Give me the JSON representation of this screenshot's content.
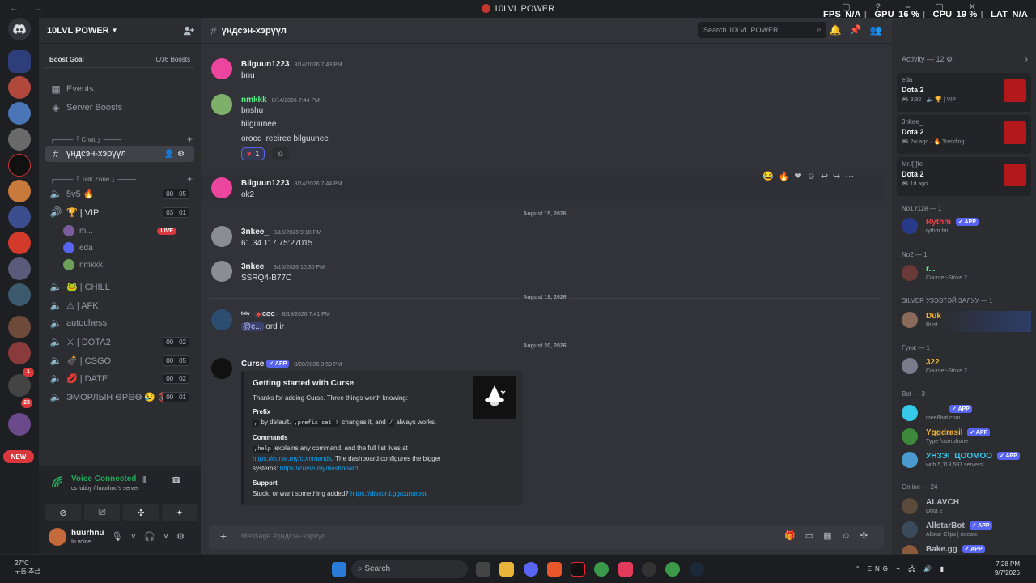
{
  "window": {
    "title": "10LVL POWER",
    "nav": "← →"
  },
  "overlay": {
    "fps_label": "FPS",
    "fps": "N/A",
    "gpu_label": "GPU",
    "gpu": "16 %",
    "cpu_label": "CPU",
    "cpu": "19 %",
    "lat_label": "LAT",
    "lat": "N/A"
  },
  "guild_rail": {
    "new_label": "NEW",
    "badge_1": "1",
    "badge_23": "23"
  },
  "server": {
    "name": "10LVL POWER",
    "boost_goal": "Boost Goal",
    "boost_count": "0/36 Boosts",
    "events": "Events",
    "server_boosts": "Server Boosts",
    "cat_chat": "┌────「 Chat 」────",
    "cat_talk": "┌────「 Talk Zone 」────",
    "active_channel": "үндсэн-хэрүүл",
    "voice_channels": [
      {
        "name": "5v5 🔥",
        "a": "00",
        "b": "05"
      },
      {
        "name": "🏆 | VIP",
        "a": "03",
        "b": "01"
      },
      {
        "name": "🐸 | CHILL"
      },
      {
        "name": "⚠ | AFK"
      },
      {
        "name": "autochess"
      },
      {
        "name": "⚔ | DOTA2",
        "a": "00",
        "b": "02"
      },
      {
        "name": "💣 | CSGO",
        "a": "00",
        "b": "05"
      },
      {
        "name": "💋 | DATE",
        "a": "00",
        "b": "02"
      },
      {
        "name": "ЭМОРЛЫН ӨРӨӨ 😢 🚷",
        "a": "00",
        "b": "01"
      }
    ],
    "vip_users": [
      {
        "name": "m...",
        "live": "LIVE"
      },
      {
        "name": "eda"
      },
      {
        "name": "nmkkk"
      }
    ]
  },
  "voice_panel": {
    "status": "Voice Connected",
    "location": "cs lobby / huurhnu's server"
  },
  "user_panel": {
    "name": "huurhnu",
    "status": "In voice"
  },
  "channel_header": {
    "name": "үндсэн-хэрүүл"
  },
  "search": {
    "placeholder": "Search 10LVL POWER"
  },
  "messages": {
    "m1": {
      "user": "Bilguun1223",
      "time": "8/14/2026 7:43 PM",
      "text": "bnu"
    },
    "m2": {
      "user": "nmkkk",
      "time": "8/14/2026 7:44 PM",
      "lines": [
        "bnshu",
        "bilguunee",
        "orood ireeiree bilguunee"
      ],
      "reaction_count": "1"
    },
    "m3": {
      "user": "Bilguun1223",
      "time": "8/14/2026 7:44 PM",
      "text": "ok2"
    },
    "date1": "August 15, 2026",
    "m4": {
      "user": "3nkee_",
      "time": "8/15/2026 9:10 PM",
      "text": "61.34.117.75:27015"
    },
    "m5": {
      "user": "3nkee_",
      "time": "8/15/2026 10:30 PM",
      "text": "SSRQ4-B77C"
    },
    "date2": "August 19, 2026",
    "m6": {
      "user": "ᵇᵃᵇʸ",
      "tag": "CGC",
      "time": "8/19/2026 7:41 PM",
      "mention": "@c...",
      "text": "ord ir"
    },
    "date3": "August 20, 2026",
    "m7": {
      "user": "Curse",
      "app": "APP",
      "time": "8/20/2026 3:59 PM"
    }
  },
  "embed": {
    "title": "Getting started with Curse",
    "intro": "Thanks for adding Curse. Three things worth knowing:",
    "prefix_head": "Prefix",
    "prefix_code1": ",",
    "prefix_t1": " by default. ",
    "prefix_code2": ",prefix set !",
    "prefix_t2": " changes it, and ",
    "prefix_code3": "/",
    "prefix_t3": " always works.",
    "commands_head": "Commands",
    "commands_code": ",help",
    "commands_t1": " explains any command, and the full list lives at ",
    "commands_link1": "https://curse.my/commands",
    "commands_t2": ". The dashboard configures the bigger systems: ",
    "commands_link2": "https://curse.my/dashboard",
    "support_head": "Support",
    "support_t": "Stuck, or want something added? ",
    "support_link": "https://discord.gg/cursebot"
  },
  "composer": {
    "placeholder": "Message #үндсэн-хэрүүл"
  },
  "members_panel": {
    "activity_title": "Activity — 12",
    "cards": [
      {
        "who": "eda",
        "game": "Dota 2",
        "meta": "🎮 9:32 · 🔈 🏆 | VIP"
      },
      {
        "who": "3nkee_",
        "game": "Dota 2",
        "meta": "🎮 2w ago · 🔥 Trending"
      },
      {
        "who": "Mr.l[!]fe",
        "game": "Dota 2",
        "meta": "🎮 1d ago"
      }
    ],
    "groups": {
      "no1": "No1 r1ze — 1",
      "no2": "No2 — 1",
      "silver": "SILVER УЗЭЭТЭЙ ЗАЛУУ — 1",
      "gunzh": "Гүнж — 1",
      "bot": "Bot — 3",
      "online": "Online — 24"
    },
    "members": {
      "rythm": {
        "name": "Rythm",
        "status": "rythm.fm",
        "app": "APP"
      },
      "r": {
        "name": "r...",
        "status": "Counter-Strike 2"
      },
      "duk": {
        "name": "Duk",
        "status": "Rust"
      },
      "n322": {
        "name": "322",
        "status": "Counter-Strike 2"
      },
      "mee6": {
        "name": "",
        "status": "mee6bot.com",
        "app": "APP"
      },
      "yggdrasil": {
        "name": "Yggdrasil",
        "status": "Type /userphone",
        "app": "APP"
      },
      "unzeg": {
        "name": "УНЗЭГ ЦООМОО",
        "status": "with 5,113,597 servers!",
        "app": "APP"
      },
      "alavch": {
        "name": "ALAVCH",
        "status": "Dota 2"
      },
      "allstar": {
        "name": "AllstarBot",
        "status": "Allstar Clips | /create",
        "app": "APP"
      },
      "bake": {
        "name": "Bake.gg",
        "status": "",
        "app": "APP"
      }
    }
  },
  "taskbar": {
    "temp": "27°C",
    "weather": "구름 조금",
    "search": "Search",
    "tray": "^ ENG",
    "time": "7:28 PM",
    "date": "9/7/2026"
  },
  "colors": {
    "accent": "#5865f2",
    "online": "#23a55a",
    "danger": "#da373c",
    "link": "#00a8fc"
  }
}
